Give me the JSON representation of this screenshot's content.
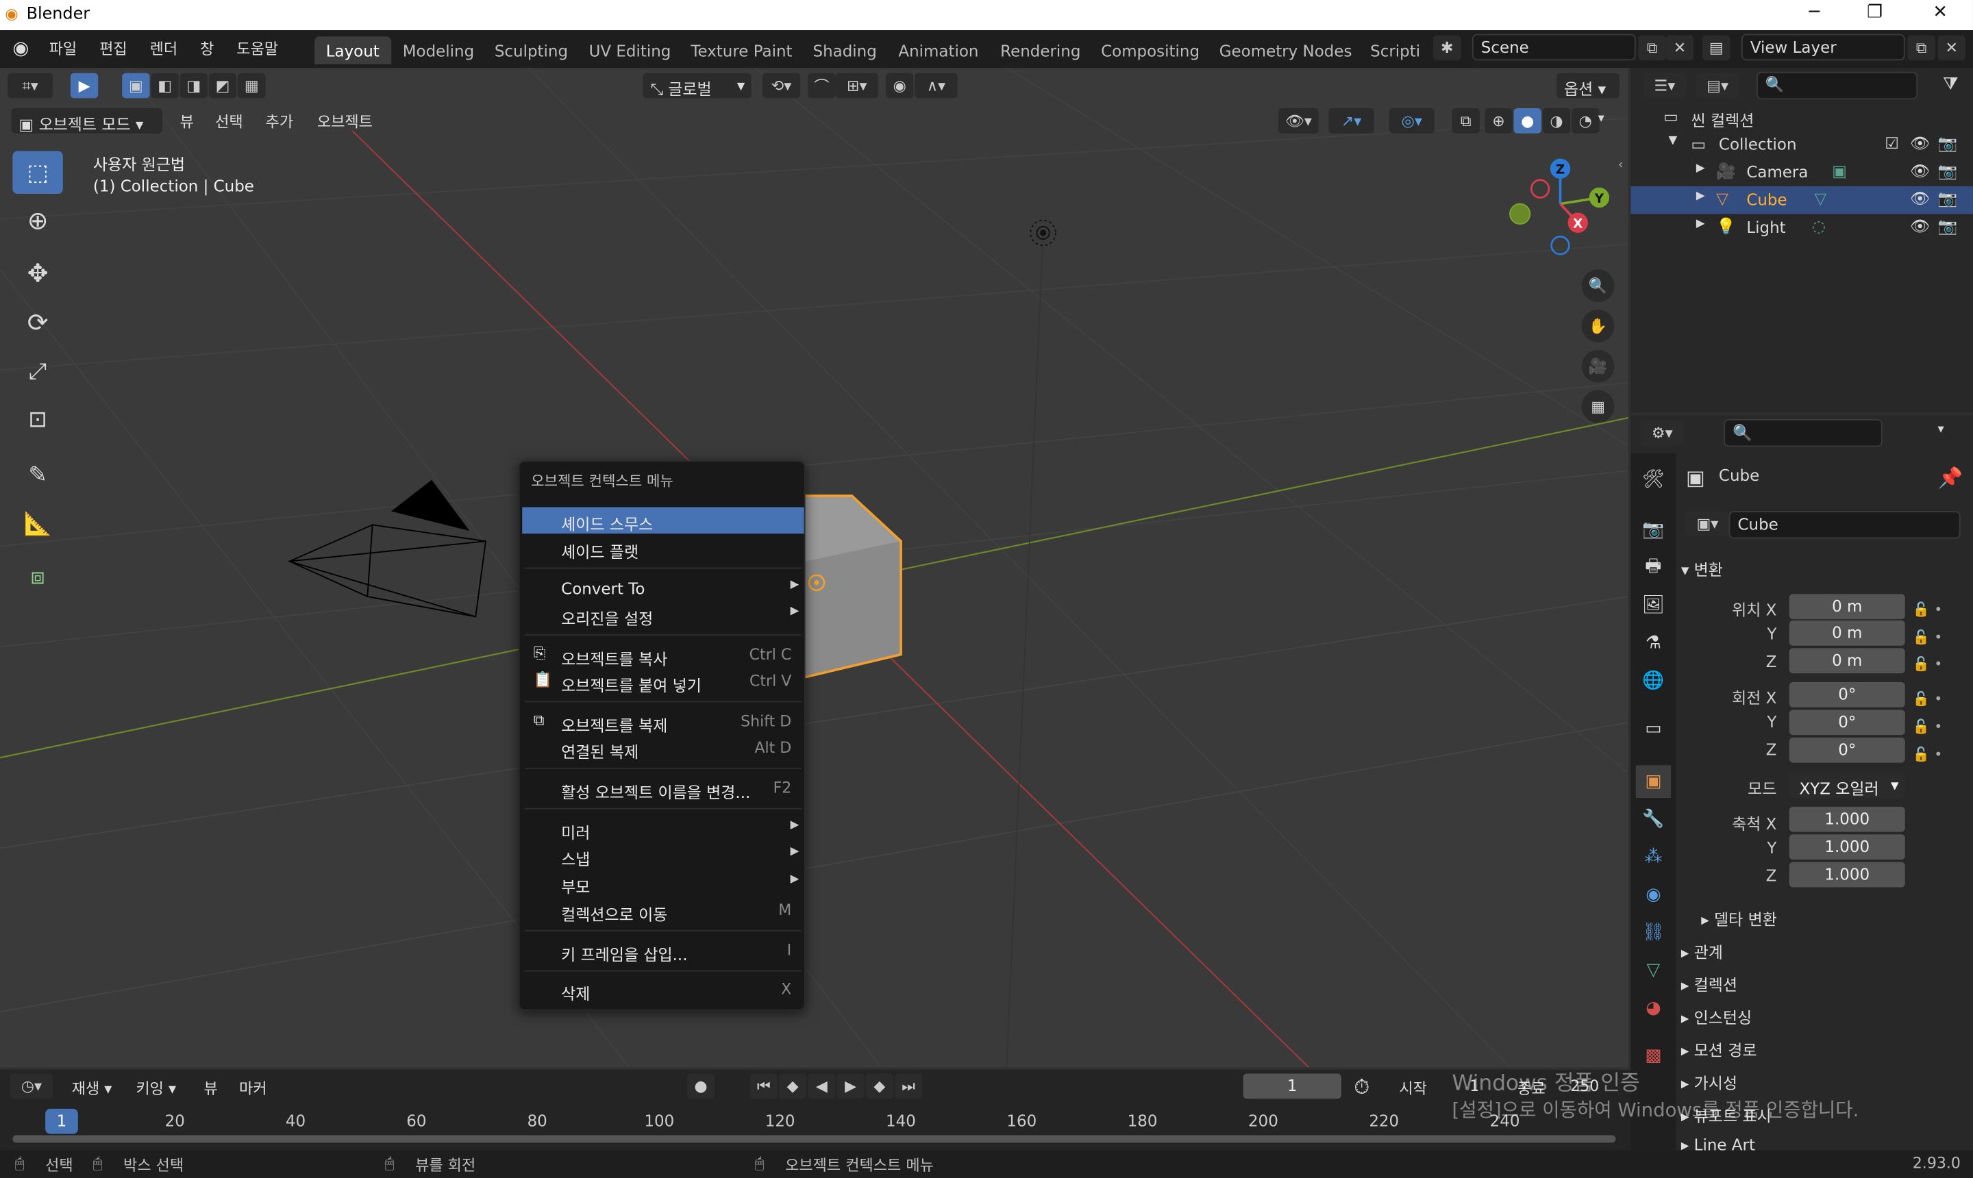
{
  "app": {
    "title": "Blender",
    "version": "2.93.0"
  },
  "menubar": [
    "파일",
    "편집",
    "렌더",
    "창",
    "도움말"
  ],
  "workspaces": [
    "Layout",
    "Modeling",
    "Sculpting",
    "UV Editing",
    "Texture Paint",
    "Shading",
    "Animation",
    "Rendering",
    "Compositing",
    "Geometry Nodes",
    "Scripti"
  ],
  "scene": "Scene",
  "view_layer": "View Layer",
  "viewport": {
    "mode": "오브젝트 모드",
    "menus": [
      "뷰",
      "선택",
      "추가",
      "오브젝트"
    ],
    "orientation": "글로벌",
    "options": "옵션",
    "view_name": "사용자 원근법",
    "collection_info": "(1) Collection | Cube",
    "gizmo": {
      "x": "X",
      "y": "Y",
      "z": "Z"
    }
  },
  "context_menu": {
    "title": "오브젝트 컨텍스트 메뉴",
    "items": [
      {
        "label": "셰이드 스무스",
        "shortcut": ""
      },
      {
        "label": "셰이드 플랫",
        "shortcut": ""
      },
      {
        "label": "Convert To",
        "shortcut": ""
      },
      {
        "label": "오리진을 설정",
        "shortcut": ""
      },
      {
        "label": "오브젝트를 복사",
        "shortcut": "Ctrl C"
      },
      {
        "label": "오브젝트를 붙여 넣기",
        "shortcut": "Ctrl V"
      },
      {
        "label": "오브젝트를 복제",
        "shortcut": "Shift D"
      },
      {
        "label": "연결된 복제",
        "shortcut": "Alt D"
      },
      {
        "label": "활성 오브젝트 이름을 변경...",
        "shortcut": "F2"
      },
      {
        "label": "미러",
        "shortcut": ""
      },
      {
        "label": "스냅",
        "shortcut": ""
      },
      {
        "label": "부모",
        "shortcut": ""
      },
      {
        "label": "컬렉션으로 이동",
        "shortcut": "M"
      },
      {
        "label": "키 프레임을 삽입...",
        "shortcut": "I"
      },
      {
        "label": "삭제",
        "shortcut": "X"
      }
    ]
  },
  "outliner": {
    "scene_collection": "씬 컬렉션",
    "collection": "Collection",
    "items": [
      "Camera",
      "Cube",
      "Light"
    ]
  },
  "properties": {
    "object_name": "Cube",
    "data_name": "Cube",
    "transform_header": "변환",
    "location_label": "위치",
    "rotation_label": "회전",
    "scale_label": "축척",
    "mode_label": "모드",
    "axes": [
      "X",
      "Y",
      "Z"
    ],
    "location": [
      "0 m",
      "0 m",
      "0 m"
    ],
    "rotation": [
      "0°",
      "0°",
      "0°"
    ],
    "mode": "XYZ 오일러",
    "scale": [
      "1.000",
      "1.000",
      "1.000"
    ],
    "delta": "델타 변환",
    "sections": [
      "관계",
      "컬렉션",
      "인스턴싱",
      "모션 경로",
      "가시성",
      "뷰포트 표시",
      "Line Art"
    ]
  },
  "timeline": {
    "playback": "재생",
    "keying": "키잉",
    "view": "뷰",
    "marker": "마커",
    "current_frame": "1",
    "start_label": "시작",
    "start": "1",
    "end_label": "종료",
    "end": "250",
    "frame_marker": "1",
    "ticks": [
      "20",
      "40",
      "60",
      "80",
      "100",
      "120",
      "140",
      "160",
      "180",
      "200",
      "220",
      "240"
    ]
  },
  "statusbar": {
    "select": "선택",
    "box_select": "박스 선택",
    "rotate_view": "뷰를 회전",
    "context_menu": "오브젝트 컨텍스트 메뉴"
  },
  "watermark": {
    "line1": "Windows 정품 인증",
    "line2": "[설정]으로 이동하여 Windows를 정품 인증합니다."
  }
}
